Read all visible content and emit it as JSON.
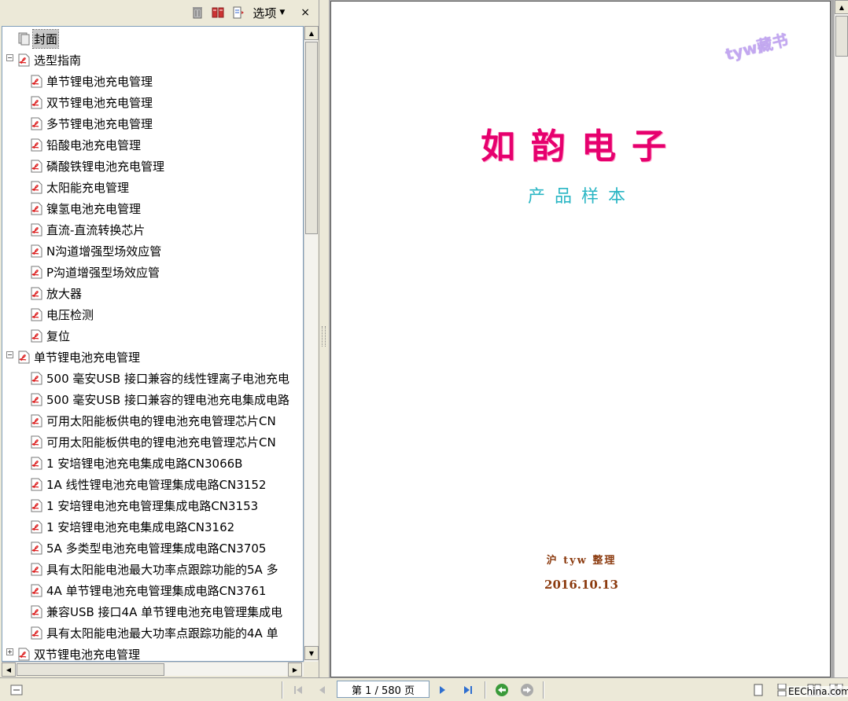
{
  "panel_toolbar": {
    "options_label": "选项",
    "close_label": "×"
  },
  "bookmarks": {
    "cover": "封面",
    "guide": {
      "label": "选型指南",
      "children": [
        "单节锂电池充电管理",
        "双节锂电池充电管理",
        "多节锂电池充电管理",
        "铅酸电池充电管理",
        "磷酸铁锂电池充电管理",
        "太阳能充电管理",
        "镍氢电池充电管理",
        "直流-直流转换芯片",
        "N沟道增强型场效应管",
        "P沟道增强型场效应管",
        "放大器",
        "电压检测",
        "复位"
      ]
    },
    "single_cell": {
      "label": "单节锂电池充电管理",
      "children": [
        "500 毫安USB 接口兼容的线性锂离子电池充电",
        "500 毫安USB 接口兼容的锂电池充电集成电路",
        "可用太阳能板供电的锂电池充电管理芯片CN",
        "可用太阳能板供电的锂电池充电管理芯片CN",
        "1 安培锂电池充电集成电路CN3066B",
        "1A 线性锂电池充电管理集成电路CN3152",
        "1 安培锂电池充电管理集成电路CN3153",
        "1 安培锂电池充电集成电路CN3162",
        "5A 多类型电池充电管理集成电路CN3705",
        "具有太阳能电池最大功率点跟踪功能的5A 多",
        "4A 单节锂电池充电管理集成电路CN3761",
        "兼容USB 接口4A 单节锂电池充电管理集成电",
        "具有太阳能电池最大功率点跟踪功能的4A 单"
      ]
    },
    "dual_cell": "双节锂电池充电管理"
  },
  "document": {
    "watermark": "tyw藏书",
    "company": "如韵电子",
    "subtitle": "产品样本",
    "credit": "沪 tyw 整理",
    "date": "2016.10.13"
  },
  "navigation": {
    "page_text": "第 1 / 580 页",
    "site_tag": "EEChina.com"
  },
  "colors": {
    "company": "#e6006e",
    "subtitle": "#2ab6c4",
    "credit": "#8b3a0e",
    "watermark": "#c3a8f0"
  }
}
